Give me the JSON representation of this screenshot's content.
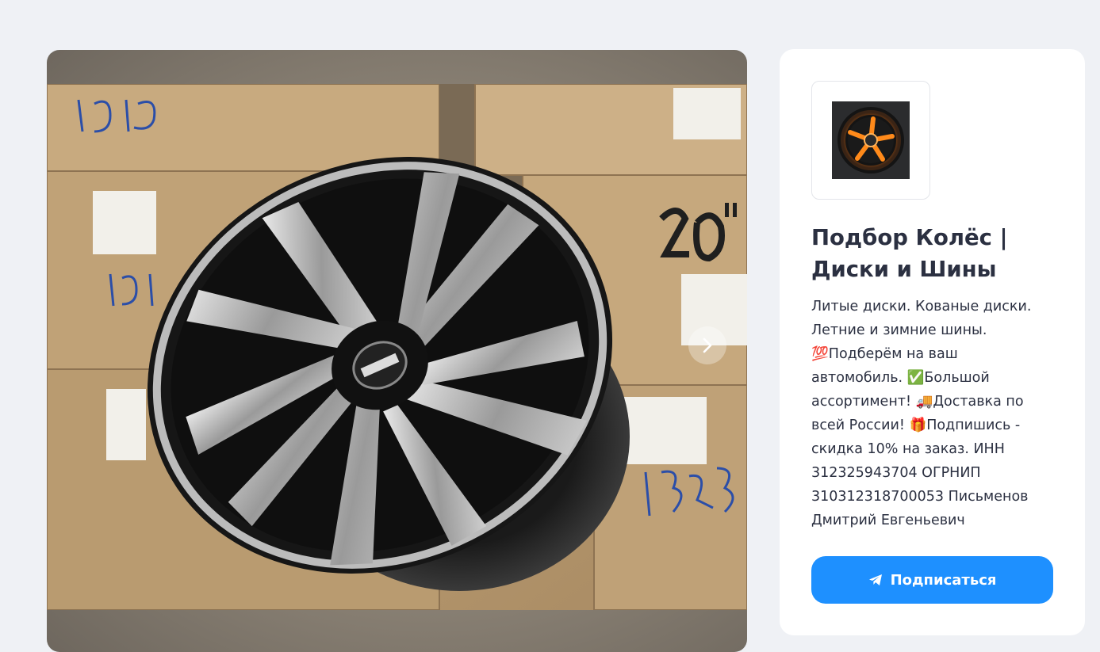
{
  "gallery": {
    "photo_alt": "",
    "next_icon": "chevron-right-icon"
  },
  "channel": {
    "avatar_icon": "wheel-logo-icon",
    "title": "Подбор Колёс | Диски и Шины",
    "description": " Литые диски.  Кованые диски. Летние и зимние шины. 💯Подберём на ваш автомобиль. ✅Большой ассортимент! 🚚Доставка по всей России! 🎁Подпишись - скидка 10% на заказ. ИНН 312325943704 ОГРНИП 310312318700053 Письменов Дмитрий Евгеньевич",
    "subscribe_label": "Подписаться",
    "subscribe_icon": "telegram-plane-icon"
  },
  "colors": {
    "page_bg": "#eff1f5",
    "card_bg": "#ffffff",
    "accent": "#1e90ff",
    "text": "#2b3041"
  }
}
